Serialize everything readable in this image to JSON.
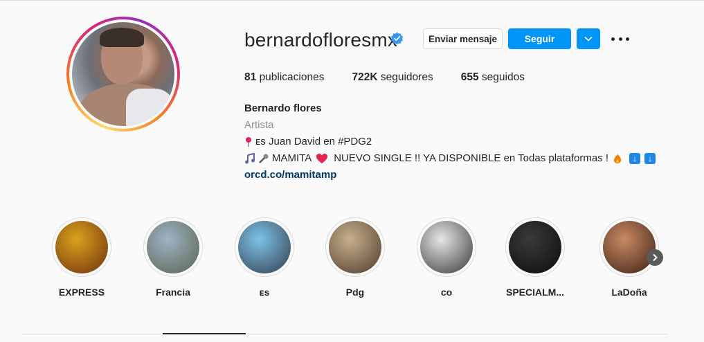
{
  "profile": {
    "username": "bernardofloresmx",
    "message_button": "Enviar mensaje",
    "follow_button": "Seguir",
    "stats": [
      {
        "value": "81",
        "label": "publicaciones"
      },
      {
        "value": "722K",
        "label": "seguidores"
      },
      {
        "value": "655",
        "label": "seguidos"
      }
    ],
    "full_name": "Bernardo flores",
    "category": "Artista",
    "bio_line1": "ᴇs Juan David en #PDG2",
    "bio_line2": "MAMITA",
    "bio_line2_rest": "NUEVO SINGLE !! YA DISPONIBLE en Todas plataformas !",
    "link": "orcd.co/mamitamp"
  },
  "highlights": [
    {
      "label": "EXPRESS",
      "colors": [
        "#d9a21c",
        "#7a3b12"
      ]
    },
    {
      "label": "Francia",
      "colors": [
        "#9fb3c6",
        "#5f6b5a"
      ]
    },
    {
      "label": "ᴇs",
      "colors": [
        "#7cc3e8",
        "#3b4a5a"
      ]
    },
    {
      "label": "Pdg",
      "colors": [
        "#c8b08c",
        "#5a4636"
      ]
    },
    {
      "label": "co",
      "colors": [
        "#e6e6e6",
        "#4a4a4a"
      ]
    },
    {
      "label": "SPECIALM...",
      "colors": [
        "#3a3a3a",
        "#111111"
      ]
    },
    {
      "label": "LaDoña",
      "colors": [
        "#c98a62",
        "#4a2a1e"
      ]
    }
  ],
  "colors": {
    "accent": "#0095f6",
    "verified": "#3897f0",
    "link": "#00376b"
  },
  "icons": {
    "verified": "verified-badge-icon",
    "dropdown": "chevron-down-icon",
    "more": "more-options-icon",
    "next": "chevron-right-icon"
  }
}
